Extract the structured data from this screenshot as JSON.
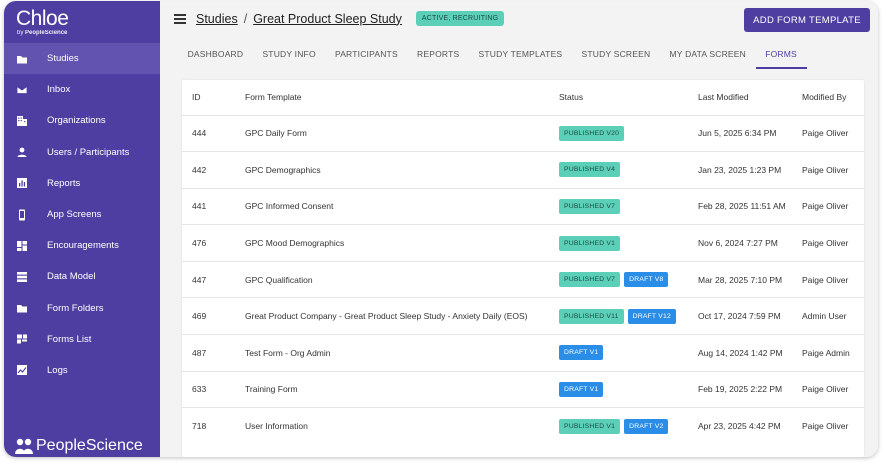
{
  "app": {
    "logo_main": "Chloe",
    "logo_sub_prefix": "by ",
    "logo_sub_brand": "PeopleScience",
    "bottom_brand": "PeopleScience"
  },
  "sidebar": {
    "items": [
      {
        "label": "Studies",
        "icon": "folder-icon",
        "active": true
      },
      {
        "label": "Inbox",
        "icon": "mail-icon"
      },
      {
        "label": "Organizations",
        "icon": "building-icon"
      },
      {
        "label": "Users / Participants",
        "icon": "person-icon"
      },
      {
        "label": "Reports",
        "icon": "bar-chart-icon"
      },
      {
        "label": "App Screens",
        "icon": "phone-icon"
      },
      {
        "label": "Encouragements",
        "icon": "dashboard-icon"
      },
      {
        "label": "Data Model",
        "icon": "storage-icon"
      },
      {
        "label": "Form Folders",
        "icon": "folder-icon"
      },
      {
        "label": "Forms List",
        "icon": "forms-list-icon"
      },
      {
        "label": "Logs",
        "icon": "line-chart-icon"
      }
    ]
  },
  "header": {
    "crumb_root": "Studies",
    "crumb_separator": "/",
    "crumb_study": "Great Product Sleep Study",
    "status": "ACTIVE, RECRUITING",
    "add_button": "ADD FORM TEMPLATE"
  },
  "tabs": [
    {
      "label": "DASHBOARD"
    },
    {
      "label": "STUDY INFO"
    },
    {
      "label": "PARTICIPANTS"
    },
    {
      "label": "REPORTS"
    },
    {
      "label": "STUDY TEMPLATES"
    },
    {
      "label": "STUDY SCREEN"
    },
    {
      "label": "MY DATA SCREEN"
    },
    {
      "label": "FORMS",
      "active": true
    }
  ],
  "table": {
    "columns": {
      "id": "ID",
      "form": "Form Template",
      "status": "Status",
      "modified": "Last Modified",
      "by": "Modified By"
    },
    "rows": [
      {
        "id": "444",
        "form": "GPC Daily Form",
        "badges": [
          {
            "label": "PUBLISHED V20",
            "kind": "published"
          }
        ],
        "modified": "Jun 5, 2025 6:34 PM",
        "by": "Paige Oliver"
      },
      {
        "id": "442",
        "form": "GPC Demographics",
        "badges": [
          {
            "label": "PUBLISHED V4",
            "kind": "published"
          }
        ],
        "modified": "Jan 23, 2025 1:23 PM",
        "by": "Paige Oliver"
      },
      {
        "id": "441",
        "form": "GPC Informed Consent",
        "badges": [
          {
            "label": "PUBLISHED V7",
            "kind": "published"
          }
        ],
        "modified": "Feb 28, 2025 11:51 AM",
        "by": "Paige Oliver"
      },
      {
        "id": "476",
        "form": "GPC Mood Demographics",
        "badges": [
          {
            "label": "PUBLISHED V1",
            "kind": "published"
          }
        ],
        "modified": "Nov 6, 2024 7:27 PM",
        "by": "Paige Oliver"
      },
      {
        "id": "447",
        "form": "GPC Qualification",
        "badges": [
          {
            "label": "PUBLISHED V7",
            "kind": "published"
          },
          {
            "label": "DRAFT V8",
            "kind": "draft"
          }
        ],
        "modified": "Mar 28, 2025 7:10 PM",
        "by": "Paige Oliver"
      },
      {
        "id": "469",
        "form": "Great Product Company - Great Product Sleep Study - Anxiety Daily (EOS)",
        "badges": [
          {
            "label": "PUBLISHED V11",
            "kind": "published"
          },
          {
            "label": "DRAFT V12",
            "kind": "draft"
          }
        ],
        "modified": "Oct 17, 2024 7:59 PM",
        "by": "Admin User"
      },
      {
        "id": "487",
        "form": "Test Form - Org Admin",
        "badges": [
          {
            "label": "DRAFT V1",
            "kind": "draft"
          }
        ],
        "modified": "Aug 14, 2024 1:42 PM",
        "by": "Paige Admin"
      },
      {
        "id": "633",
        "form": "Training Form",
        "badges": [
          {
            "label": "DRAFT V1",
            "kind": "draft"
          }
        ],
        "modified": "Feb 19, 2025 2:22 PM",
        "by": "Paige Oliver"
      },
      {
        "id": "718",
        "form": "User Information",
        "badges": [
          {
            "label": "PUBLISHED V1",
            "kind": "published"
          },
          {
            "label": "DRAFT V2",
            "kind": "draft"
          }
        ],
        "modified": "Apr 23, 2025 4:42 PM",
        "by": "Paige Oliver"
      }
    ]
  },
  "colors": {
    "sidebar": "#4f3ea2",
    "sidebar_active": "#6253b0",
    "published": "#5ccfb8",
    "draft": "#2a8ee8"
  }
}
